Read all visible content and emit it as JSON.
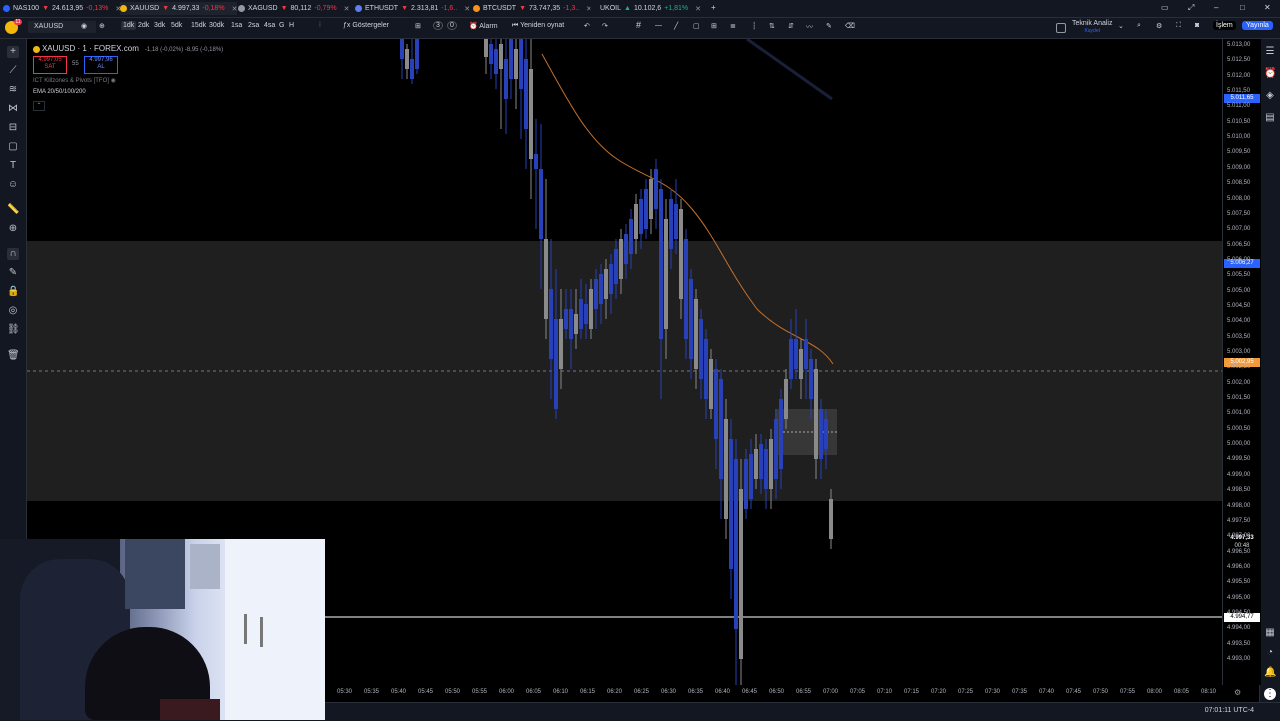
{
  "tabs": [
    {
      "symbol": "NAS100",
      "price": "24.613,95",
      "change": "-0,13%",
      "dir": "neg",
      "color": "#2962ff"
    },
    {
      "symbol": "XAUUSD",
      "price": "4.997,33",
      "change": "-0,18%",
      "dir": "neg",
      "color": "#f0b90b",
      "active": true
    },
    {
      "symbol": "XAGUSD",
      "price": "80,112",
      "change": "-0,79%",
      "dir": "neg",
      "color": "#9598a1"
    },
    {
      "symbol": "ETHUSDT",
      "price": "2.313,81",
      "change": "-1,6..",
      "dir": "neg",
      "color": "#627eea"
    },
    {
      "symbol": "BTCUSDT",
      "price": "73.747,35",
      "change": "-1,3..",
      "dir": "neg",
      "color": "#f7931a"
    },
    {
      "symbol": "UKOIL",
      "price": "10.102,6",
      "change": "+1,81%",
      "dir": "pos",
      "color": "#131722"
    }
  ],
  "toolbar": {
    "symbol": "XAUUSD",
    "timeframes": [
      "1dk",
      "2dk",
      "3dk",
      "5dk",
      "15dk",
      "30dk",
      "1sa",
      "2sa",
      "4sa",
      "G",
      "H"
    ],
    "active_timeframe": "1dk",
    "indicators_label": "Göstergeler",
    "indicator_count": "3",
    "indicator_count2": "0",
    "alarm_label": "Alarm",
    "replay_label": "Yeniden oynat",
    "analysis_label": "Teknik Analiz",
    "analysis_sub": "Kaydet",
    "trade_label": "İşlem",
    "publish_label": "Yayınla"
  },
  "legend": {
    "title": "XAUUSD · 1 · FOREX.com",
    "change": "-1,18 (-0,02%) -8,95 (-0,18%)",
    "sell_price": "4.997,05",
    "sell_label": "SAT",
    "spread": "55",
    "buy_price": "4.997,96",
    "buy_label": "AL",
    "indicator1": "ICT Killzones & Pivots [TFO]",
    "indicator2": "EMA 20/50/100/200"
  },
  "price_axis": {
    "ticks": [
      "5.013,00",
      "5.012,50",
      "5.012,00",
      "5.011,50",
      "5.011,00",
      "5.010,50",
      "5.010,00",
      "5.009,50",
      "5.009,00",
      "5.008,50",
      "5.008,00",
      "5.007,50",
      "5.007,00",
      "5.006,50",
      "5.006,00",
      "5.005,50",
      "5.005,00",
      "5.004,50",
      "5.004,00",
      "5.003,50",
      "5.003,00",
      "5.002,50",
      "5.002,00",
      "5.001,50",
      "5.001,00",
      "5.000,50",
      "5.000,00",
      "4.999,50",
      "4.999,00",
      "4.998,50",
      "4.998,00",
      "4.997,50",
      "4.997,00",
      "4.996,50",
      "4.996,00",
      "4.995,50",
      "4.995,00",
      "4.994,50",
      "4.994,00",
      "4.993,50",
      "4.993,00"
    ],
    "tag_blue": "5.011,65",
    "tag_blue2": "5.006,27",
    "tag_orange": "5.002,95",
    "current_price": "4.997,33",
    "countdown": "00:48",
    "line_price": "4.994,77"
  },
  "time_axis": [
    "05:30",
    "05:35",
    "05:40",
    "05:45",
    "05:50",
    "05:55",
    "06:00",
    "06:05",
    "06:10",
    "06:15",
    "06:20",
    "06:25",
    "06:30",
    "06:35",
    "06:40",
    "06:45",
    "06:50",
    "06:55",
    "07:00",
    "07:05",
    "07:10",
    "07:15",
    "07:20",
    "07:25",
    "07:30",
    "07:35",
    "07:40",
    "07:45",
    "07:50",
    "07:55",
    "08:00",
    "08:05",
    "08:10"
  ],
  "status": {
    "clock": "07:01:11 UTC-4"
  },
  "colors": {
    "bull": "#2941b8",
    "bear": "#8a8a8a",
    "ema": "#c4702a",
    "zone": "#1f1f1f",
    "price_line": "#f29a39",
    "bg": "#000000"
  }
}
